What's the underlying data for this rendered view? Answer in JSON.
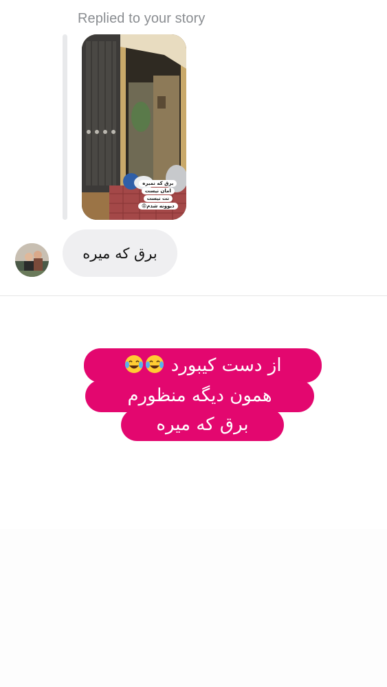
{
  "reply_context": {
    "label": "Replied to your story",
    "story_sticker_lines": [
      "برق که نمیره",
      "امان نیست",
      "نت نیست",
      "دیوونه شدم😡"
    ]
  },
  "message": {
    "text": "برق که میره",
    "bubble_color": "#efeff1"
  },
  "caption": {
    "lines": [
      "از دست کیبورد",
      "همون دیگه منظورم",
      "برق که میره"
    ],
    "emoji_icons": [
      "face-with-tears-of-joy-icon",
      "face-with-tears-of-joy-icon"
    ],
    "background_color": "#e3076f",
    "text_color": "#ffffff"
  }
}
